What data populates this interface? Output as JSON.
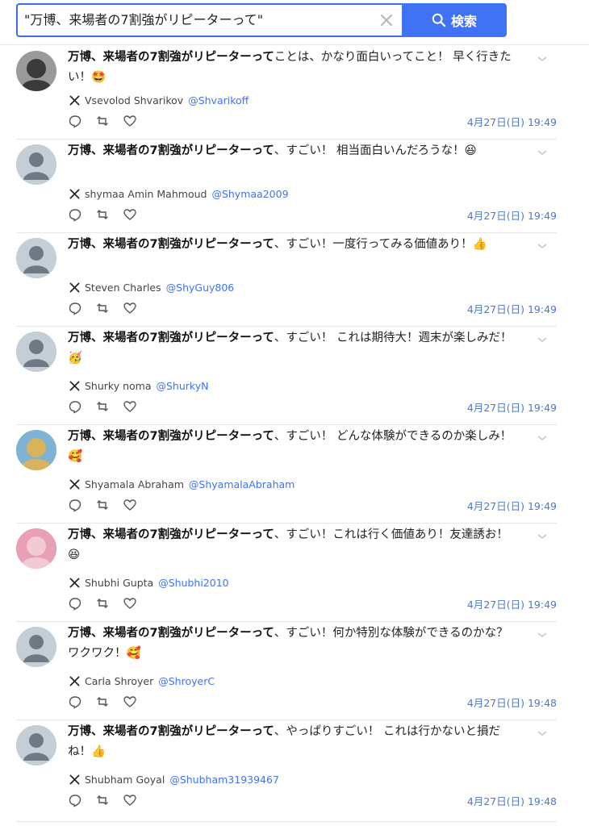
{
  "search": {
    "query": "\"万博、来場者の7割強がリピーターって\"",
    "button_label": "検索"
  },
  "posts": [
    {
      "author_name": "Vsevolod Shvarikov",
      "handle": "@Shvarikoff",
      "text_bold": "万博、来場者の7割強がリピーターって",
      "text_rest": "ことは、かなり面白いってこと！ 早く行きたい！🤩",
      "timestamp": "4月27日(日) 19:49",
      "avatar": "photo"
    },
    {
      "author_name": "shymaa Amin Mahmoud",
      "handle": "@Shymaa2009",
      "text_bold": "万博、来場者の7割強がリピーターって",
      "text_rest": "、すごい！ 相当面白いんだろうな！😆",
      "timestamp": "4月27日(日) 19:49",
      "avatar": "default"
    },
    {
      "author_name": "Steven Charles",
      "handle": "@ShyGuy806",
      "text_bold": "万博、来場者の7割強がリピーターって",
      "text_rest": "、すごい！一度行ってみる価値あり！👍",
      "timestamp": "4月27日(日) 19:49",
      "avatar": "default"
    },
    {
      "author_name": "Shurky noma",
      "handle": "@ShurkyN",
      "text_bold": "万博、来場者の7割強がリピーターって",
      "text_rest": "、すごい！ これは期待大！週末が楽しみだ！🥳",
      "timestamp": "4月27日(日) 19:49",
      "avatar": "default"
    },
    {
      "author_name": "Shyamala Abraham",
      "handle": "@ShyamalaAbraham",
      "text_bold": "万博、来場者の7割強がリピーターって",
      "text_rest": "、すごい！ どんな体験ができるのか楽しみ！🥰",
      "timestamp": "4月27日(日) 19:49",
      "avatar": "photo"
    },
    {
      "author_name": "Shubhi Gupta",
      "handle": "@Shubhi2010",
      "text_bold": "万博、来場者の7割強がリピーターって",
      "text_rest": "、すごい！これは行く価値あり！友達誘お！😆",
      "timestamp": "4月27日(日) 19:49",
      "avatar": "photo"
    },
    {
      "author_name": "Carla Shroyer",
      "handle": "@ShroyerC",
      "text_bold": "万博、来場者の7割強がリピーターって",
      "text_rest": "、すごい！何か特別な体験ができるのかな？ワクワク！🥰",
      "timestamp": "4月27日(日) 19:48",
      "avatar": "default"
    },
    {
      "author_name": "Shubham Goyal",
      "handle": "@Shubham31939467",
      "text_bold": "万博、来場者の7割強がリピーターって",
      "text_rest": "、やっぱりすごい！ これは行かないと損だね！👍",
      "timestamp": "4月27日(日) 19:48",
      "avatar": "default"
    }
  ],
  "colors": {
    "accent": "#3f72f5",
    "timestamp": "#4a78d8",
    "divider": "#e6e6e6"
  }
}
